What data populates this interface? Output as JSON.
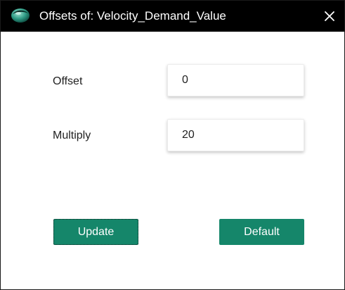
{
  "window": {
    "title": "Offsets of: Velocity_Demand_Value",
    "icon": "app-logo-icon",
    "close_icon": "close-icon"
  },
  "fields": {
    "offset": {
      "label": "Offset",
      "value": "0"
    },
    "multiply": {
      "label": "Multiply",
      "value": "20"
    }
  },
  "buttons": {
    "update_label": "Update",
    "default_label": "Default"
  },
  "colors": {
    "titlebar": "#000000",
    "button": "#15866a",
    "button_text": "#ffffff"
  }
}
